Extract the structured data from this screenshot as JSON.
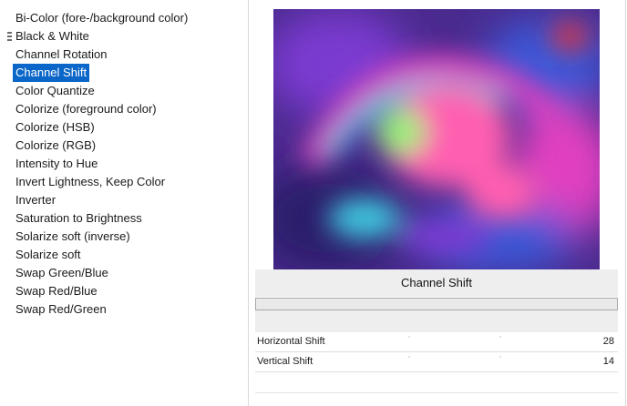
{
  "filters": {
    "items": [
      "Bi-Color (fore-/background color)",
      "Black & White",
      "Channel Rotation",
      "Channel Shift",
      "Color Quantize",
      "Colorize (foreground color)",
      "Colorize (HSB)",
      "Colorize (RGB)",
      "Intensity to Hue",
      "Invert Lightness, Keep Color",
      "Inverter",
      "Saturation to Brightness",
      "Solarize soft (inverse)",
      "Solarize soft",
      "Swap Green/Blue",
      "Swap Red/Blue",
      "Swap Red/Green"
    ],
    "selected": "Channel Shift"
  },
  "preview": {
    "icon": "blurred-color-preview-image",
    "colors": {
      "base": "#4a2a8e",
      "magenta": "#e040c0",
      "pink": "#ff5fb0",
      "green": "#9af07a",
      "cyan": "#40c8e0",
      "violet": "#7a3ad0",
      "blue": "#3a58d8",
      "red": "#e0303a",
      "dark": "#2a1a6a"
    }
  },
  "effect": {
    "title": "Channel Shift",
    "progress": 0
  },
  "params": [
    {
      "label": "Horizontal Shift",
      "value": "28"
    },
    {
      "label": "Vertical Shift",
      "value": "14"
    }
  ],
  "colors": {
    "selection": "#0a66c8",
    "panel": "#eeeeee"
  }
}
